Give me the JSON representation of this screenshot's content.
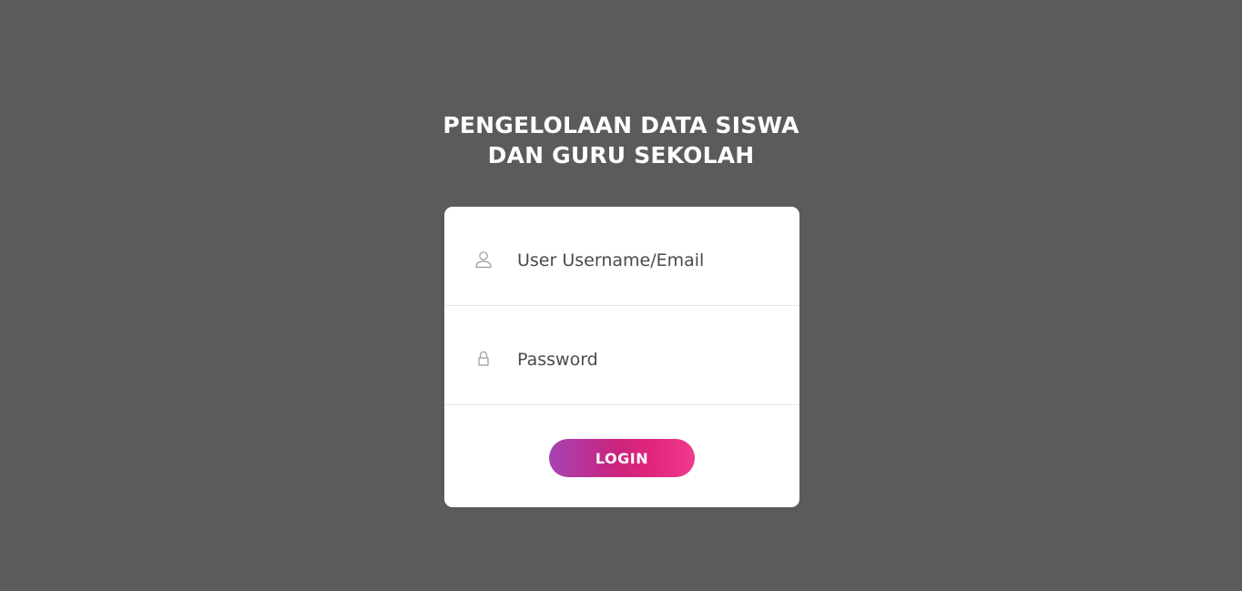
{
  "header": {
    "title_line1": "PENGELOLAAN DATA SISWA",
    "title_line2": "DAN GURU SEKOLAH"
  },
  "form": {
    "username": {
      "placeholder": "User Username/Email",
      "value": "",
      "icon": "user-icon"
    },
    "password": {
      "placeholder": "Password",
      "value": "",
      "icon": "lock-icon"
    },
    "login_label": "LOGIN"
  },
  "colors": {
    "background": "#5b5b5b",
    "card": "#ffffff",
    "button_gradient_start": "#a743b3",
    "button_gradient_mid": "#c9247f",
    "button_gradient_end": "#f03a8c"
  }
}
